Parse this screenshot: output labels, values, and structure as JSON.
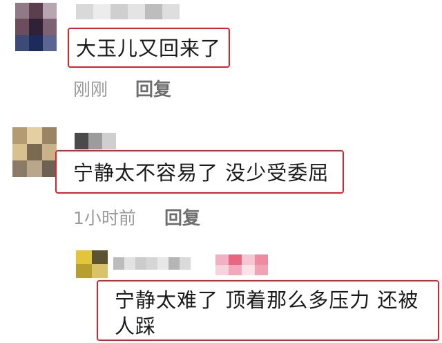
{
  "comments": [
    {
      "text": "大玉儿又回来了",
      "time": "刚刚",
      "reply_label": "回复"
    },
    {
      "text": "宁静太不容易了 没少受委屈",
      "time": "1小时前",
      "reply_label": "回复"
    }
  ],
  "reply": {
    "text_line1": "宁静太难了 顶着那么多压力 还被",
    "text_line2": "人踩"
  },
  "colors": {
    "highlight_border": "#e0212b",
    "meta_text": "#9a9a9a",
    "reply_button": "#6e6e6e"
  }
}
